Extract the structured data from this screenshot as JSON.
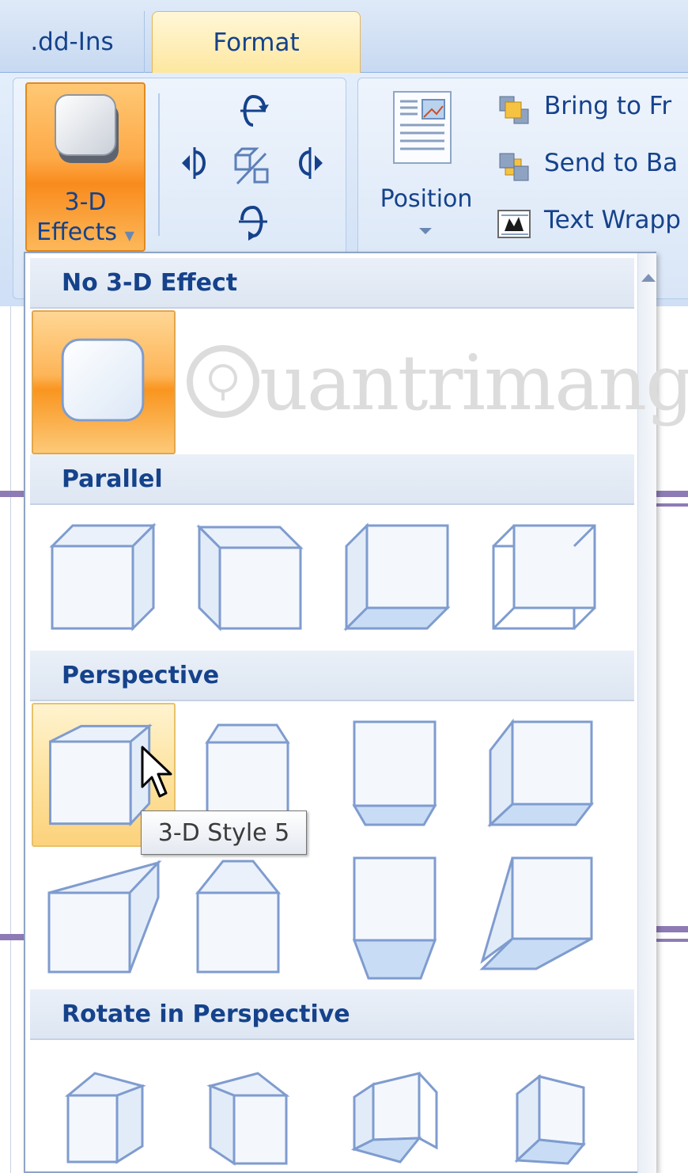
{
  "ribbon": {
    "tabs": [
      {
        "label": ".dd-Ins",
        "active": false
      },
      {
        "label": "Format",
        "active": true
      }
    ],
    "threed_effects_button": {
      "line1": "3-D",
      "line2": "Effects"
    },
    "tilt_tools": [
      "tilt-up-icon",
      "tilt-left-icon",
      "3d-toggle-icon",
      "tilt-right-icon",
      "tilt-down-icon"
    ],
    "position_button": {
      "label": "Position"
    },
    "arrange": {
      "bring_to_front": "Bring to Fr",
      "send_to_back": "Send to Ba",
      "text_wrapping": "Text Wrapp"
    }
  },
  "gallery": {
    "sections": [
      {
        "title": "No 3-D Effect",
        "items": [
          "No 3-D Effect"
        ]
      },
      {
        "title": "Parallel",
        "items": [
          "parallel-1",
          "parallel-2",
          "parallel-3",
          "parallel-4"
        ]
      },
      {
        "title": "Perspective",
        "items": [
          "3-D Style 5",
          "perspective-2",
          "perspective-3",
          "perspective-4",
          "perspective-5",
          "perspective-6",
          "perspective-7",
          "perspective-8"
        ]
      },
      {
        "title": "Rotate in Perspective",
        "items": [
          "rotate-1",
          "rotate-2",
          "rotate-3",
          "rotate-4"
        ]
      }
    ],
    "selected_item": "No 3-D Effect",
    "hovered_item": "3-D Style 5",
    "tooltip": "3-D Style 5",
    "watermark": "uantrimang"
  },
  "colors": {
    "accent_orange": "#f98b1d",
    "hover_gold": "#fde3a0",
    "text_blue": "#15428b",
    "cube_stroke": "#7f9ccf"
  }
}
